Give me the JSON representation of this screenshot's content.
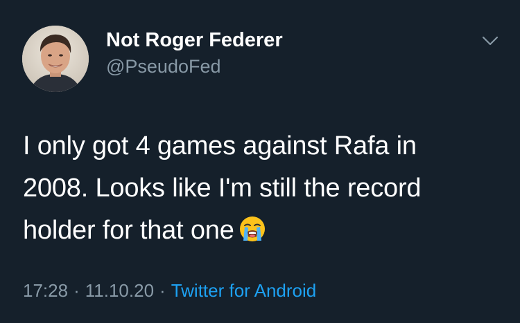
{
  "user": {
    "display_name": "Not Roger Federer",
    "handle": "@PseudoFed",
    "avatar_icon": "profile-photo"
  },
  "tweet": {
    "lines": [
      "I only got 4 games against Rafa in",
      "2008. Looks like I'm still the record",
      "holder for that one"
    ],
    "emoji": "loudly-crying-face-icon"
  },
  "meta": {
    "time": "17:28",
    "separator": "·",
    "date": "11.10.20",
    "source": "Twitter for Android"
  },
  "colors": {
    "background": "#15202b",
    "secondary_text": "#8899a6",
    "link": "#1da1f2"
  },
  "menu": {
    "caret_icon": "chevron-down-icon"
  }
}
